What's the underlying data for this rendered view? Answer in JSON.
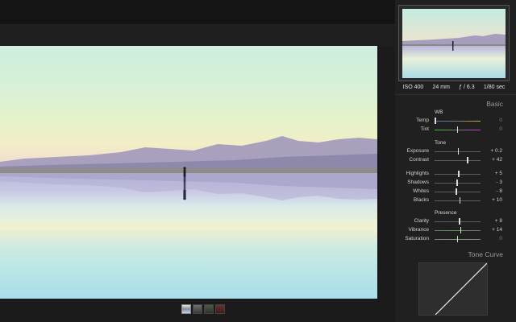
{
  "panel": {
    "exif": {
      "iso": "ISO 400",
      "focal": "24 mm",
      "aperture": "ƒ / 6.3",
      "shutter": "1/80 sec"
    },
    "basic_title": "Basic",
    "tone_curve_title": "Tone Curve",
    "groups": {
      "wb": "WB",
      "tone": "Tone",
      "presence": "Presence"
    },
    "sliders": {
      "temp": {
        "label": "Temp",
        "value": "0",
        "position": 0.02,
        "track": "temp"
      },
      "tint": {
        "label": "Tint",
        "value": "0",
        "position": 0.5,
        "track": "tint"
      },
      "exposure": {
        "label": "Exposure",
        "value": "+ 0.2",
        "position": 0.52
      },
      "contrast": {
        "label": "Contrast",
        "value": "+ 42",
        "position": 0.72
      },
      "highlights": {
        "label": "Highlights",
        "value": "+ 5",
        "position": 0.53
      },
      "shadows": {
        "label": "Shadows",
        "value": "- 3",
        "position": 0.49
      },
      "whites": {
        "label": "Whites",
        "value": "- 8",
        "position": 0.47
      },
      "blacks": {
        "label": "Blacks",
        "value": "+ 10",
        "position": 0.55
      },
      "clarity": {
        "label": "Clarity",
        "value": "+ 8",
        "position": 0.54
      },
      "vibrance": {
        "label": "Vibrance",
        "value": "+ 14",
        "position": 0.57,
        "track": "vibrance"
      },
      "saturation": {
        "label": "Saturation",
        "value": "0",
        "position": 0.5,
        "track": "saturation"
      }
    }
  },
  "colors": {
    "background": "#1b1b1b",
    "panel": "#202020",
    "text": "#cfcfcf"
  }
}
